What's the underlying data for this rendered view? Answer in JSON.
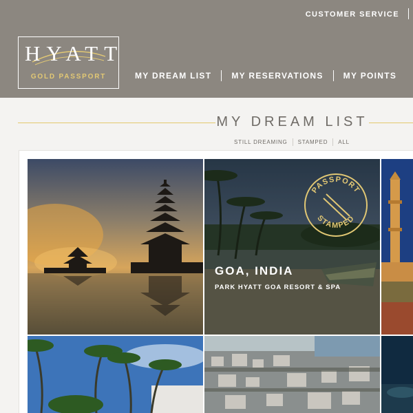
{
  "header": {
    "utility_link": "CUSTOMER SERVICE",
    "logo": {
      "word": "HYATT",
      "sub": "GOLD PASSPORT"
    },
    "nav": [
      {
        "label": "MY DREAM LIST"
      },
      {
        "label": "MY RESERVATIONS"
      },
      {
        "label": "MY POINTS"
      }
    ]
  },
  "main": {
    "title": "MY DREAM LIST",
    "filters": [
      {
        "label": "STILL DREAMING"
      },
      {
        "label": "STAMPED"
      },
      {
        "label": "ALL"
      }
    ],
    "tiles": [
      {
        "name": "bali-temple"
      },
      {
        "name": "goa-india",
        "city": "GOA, INDIA",
        "hotel": "PARK HYATT GOA RESORT & SPA",
        "stamp_top": "PASSPORT",
        "stamp_bottom": "STAMPED"
      },
      {
        "name": "minaret-tower"
      },
      {
        "name": "palm-beach"
      },
      {
        "name": "coastal-city"
      },
      {
        "name": "night-coast"
      }
    ]
  },
  "colors": {
    "header_bg": "#8c8780",
    "gold_accent": "#e2c874",
    "title_text": "#6f6b66"
  }
}
